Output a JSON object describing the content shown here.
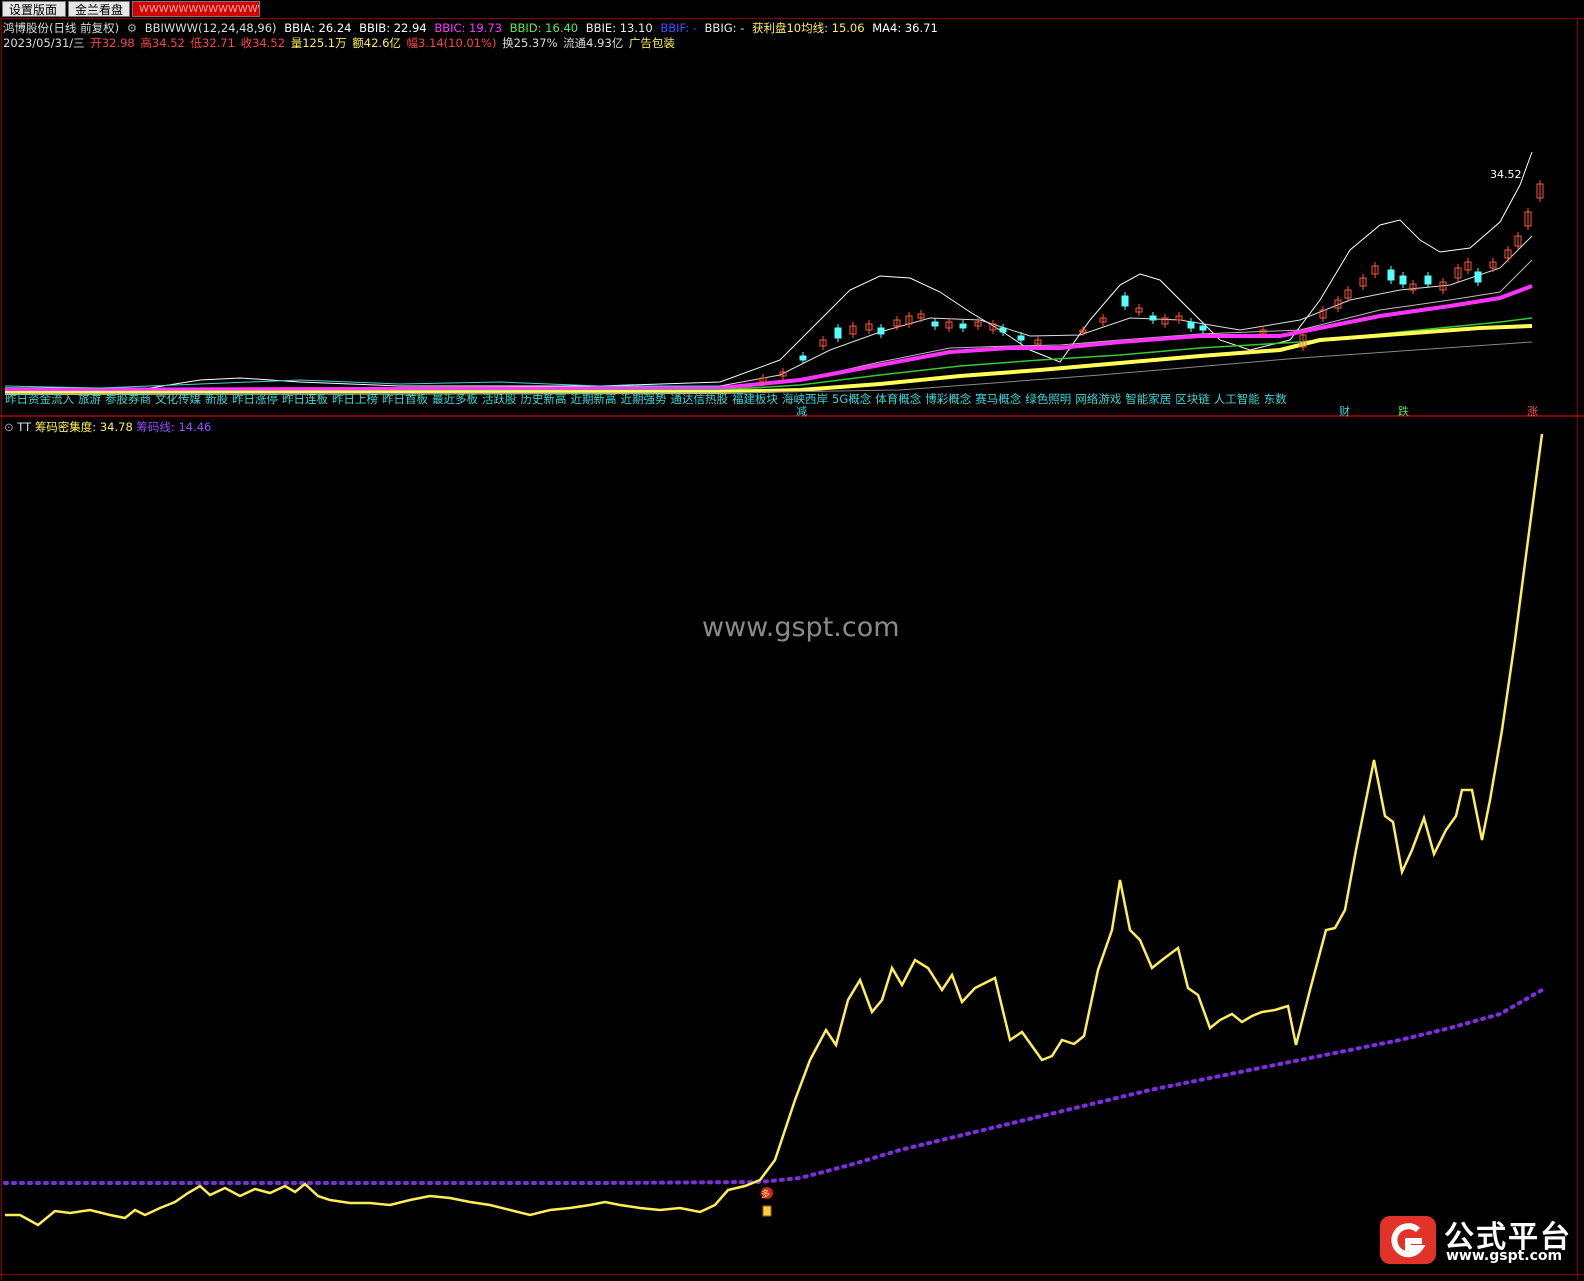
{
  "tabs": [
    {
      "label": "设置版面"
    },
    {
      "label": "金兰看盘"
    },
    {
      "label": "WWWWWWWWWWWWWW"
    }
  ],
  "stock": {
    "name": "鸿博股份(日线 前复权)",
    "indicator": "BBIWWW(12,24,48,96)",
    "bbia": "BBIA: 26.24",
    "bbib": "BBIB: 22.94",
    "bbic": "BBIC: 19.73",
    "bbid": "BBID: 16.40",
    "bbie": "BBIE: 13.10",
    "bbif": "BBIF: -",
    "bbig": "BBIG: -",
    "profit": "获利盘10均线: 15.06",
    "ma4": "MA4: 36.71"
  },
  "quote": {
    "date": "2023/05/31/三",
    "open": "开32.98",
    "high": "高34.52",
    "low": "低32.71",
    "close": "收34.52",
    "volume": "量125.1万",
    "amount": "额42.6亿",
    "change": "幅3.14(10.01%)",
    "turnover": "换25.37%",
    "float": "流通4.93亿",
    "sector": "广告包装"
  },
  "price_label": "34.52",
  "concepts": [
    "昨日资金流入",
    "旅游",
    "参股券商",
    "文化传媒",
    "新股",
    "昨日涨停",
    "昨日连板",
    "昨日上榜",
    "昨日首板",
    "最近多板",
    "活跃股",
    "历史新高",
    "近期新高",
    "近期强势",
    "通达信热股",
    "福建板块",
    "海峡西岸",
    "5G概念",
    "体育概念",
    "博彩概念",
    "赛马概念",
    "绿色照明",
    "网络游戏",
    "智能家居",
    "区块链",
    "人工智能",
    "东数"
  ],
  "markers": [
    {
      "text": "减",
      "color": "#3dd6d6"
    },
    {
      "text": "财",
      "color": "#3dd6d6"
    },
    {
      "text": "跌",
      "color": "#55dd55"
    },
    {
      "text": "涨",
      "color": "#ff5555"
    }
  ],
  "indicator_panel": {
    "name": "TT",
    "line1": "筹码密集度: 34.78",
    "line2": "筹码线: 14.46",
    "signal_text": "多"
  },
  "watermark": "www.gspt.com",
  "brand": {
    "name": "公式平台",
    "url": "www.gspt.com"
  },
  "colors": {
    "background": "#000000",
    "border": "#8a0000",
    "concentration_line": "#ffee55",
    "chip_line": "#7b2fe0",
    "bbia": "#ffffff",
    "bbic": "#ff33ff",
    "bbie": "#ffff44",
    "up_candle": "#ff5533",
    "down_candle": "#55ffff"
  }
}
